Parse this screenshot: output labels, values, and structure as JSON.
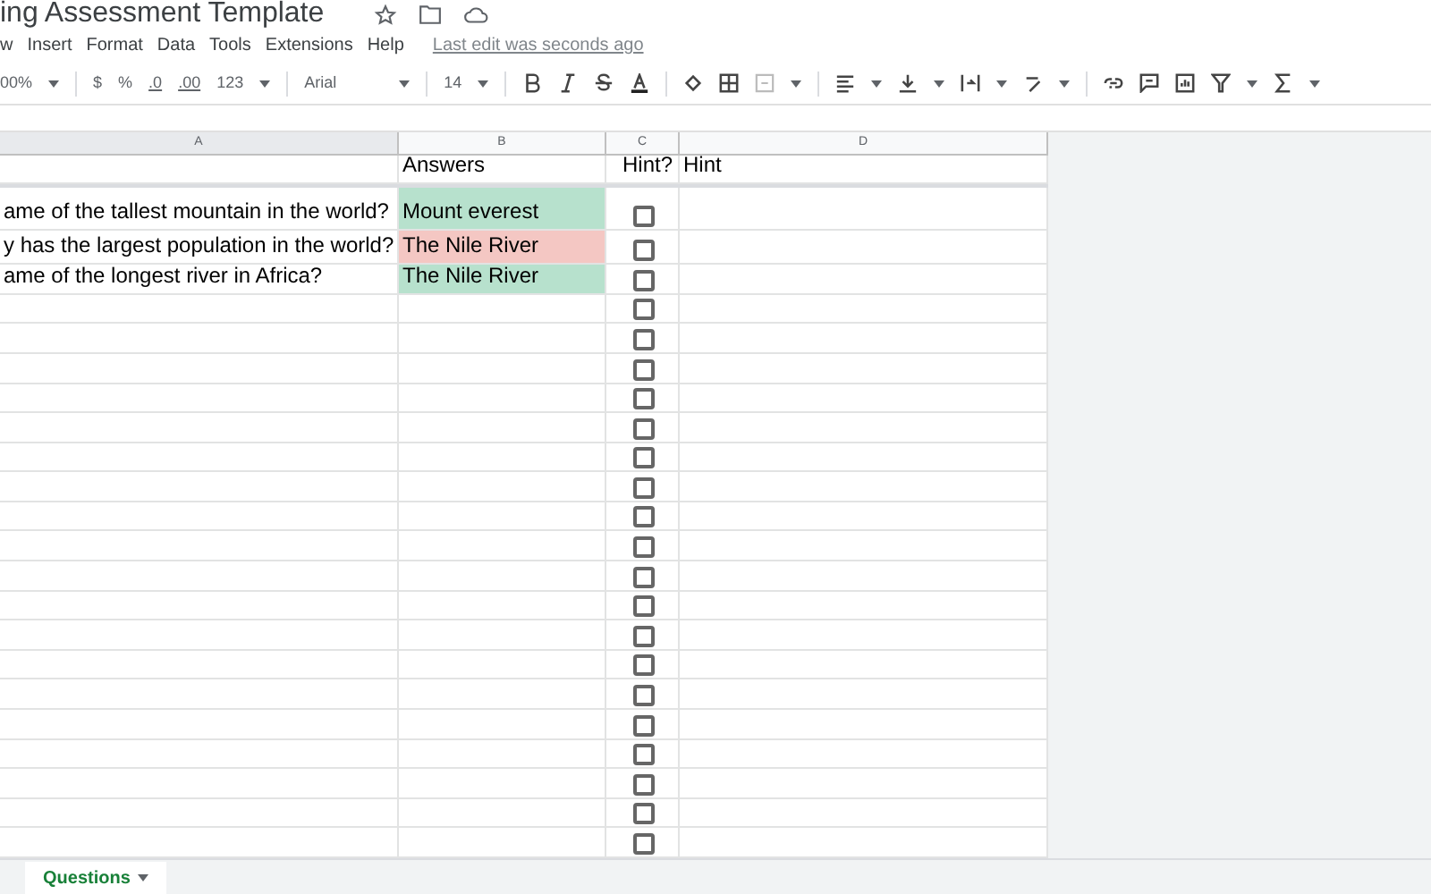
{
  "title": "ing Assessment Template",
  "menu": [
    "w",
    "Insert",
    "Format",
    "Data",
    "Tools",
    "Extensions",
    "Help"
  ],
  "last_edit": "Last edit was seconds ago",
  "toolbar": {
    "zoom": "00%",
    "currency": "$",
    "percent": "%",
    "decrease_decimals": ".0",
    "increase_decimals": ".00",
    "number_format": "123",
    "font": "Arial",
    "font_size": "14"
  },
  "columns": [
    "A",
    "B",
    "C",
    "D"
  ],
  "header_row": {
    "answers": "Answers",
    "hint_check": "Hint?",
    "hint": "Hint"
  },
  "rows": [
    {
      "question": "ame of the tallest mountain in the world?",
      "answer": "Mount everest",
      "color": "#b7e1cd",
      "hint_checked": false
    },
    {
      "question": "y has the largest population in the world?",
      "answer": "The Nile River",
      "color": "#f4c7c3",
      "hint_checked": false
    },
    {
      "question": "ame of the longest river in Africa?",
      "answer": "The Nile River",
      "color": "#b7e1cd",
      "hint_checked": false
    },
    {
      "hint_checked": false
    },
    {
      "hint_checked": false
    },
    {
      "hint_checked": false
    },
    {
      "hint_checked": false
    },
    {
      "hint_checked": false
    },
    {
      "hint_checked": false
    },
    {
      "hint_checked": false
    },
    {
      "hint_checked": false
    },
    {
      "hint_checked": false
    },
    {
      "hint_checked": false
    },
    {
      "hint_checked": false
    },
    {
      "hint_checked": false
    },
    {
      "hint_checked": false
    },
    {
      "hint_checked": false
    },
    {
      "hint_checked": false
    },
    {
      "hint_checked": false
    },
    {
      "hint_checked": false
    },
    {
      "hint_checked": false
    },
    {
      "hint_checked": false
    }
  ],
  "sheet_tabs": [
    {
      "label": "Questions",
      "selected": true
    }
  ]
}
